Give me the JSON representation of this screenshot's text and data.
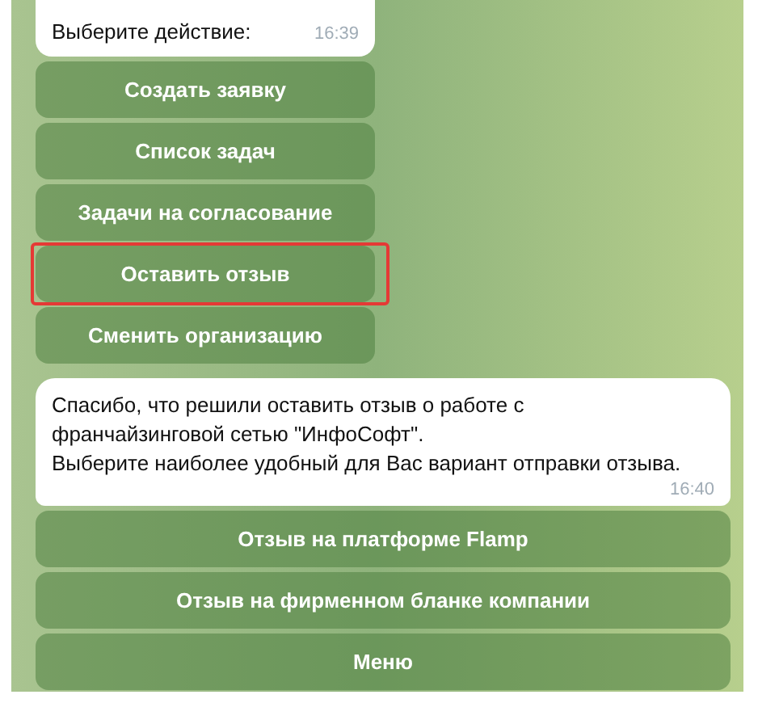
{
  "messages": [
    {
      "text": "Выберите действие:",
      "time": "16:39",
      "buttons": [
        {
          "label": "Создать заявку",
          "highlighted": false
        },
        {
          "label": "Список задач",
          "highlighted": false
        },
        {
          "label": "Задачи на согласование",
          "highlighted": false
        },
        {
          "label": "Оставить отзыв",
          "highlighted": true
        },
        {
          "label": "Сменить организацию",
          "highlighted": false
        }
      ]
    },
    {
      "text": "Спасибо, что решили оставить отзыв о работе с\nфранчайзинговой сетью \"ИнфоСофт\".\nВыберите наиболее удобный для Вас вариант отправки отзыва.",
      "time": "16:40",
      "buttons": [
        {
          "label": "Отзыв на платформе Flamp",
          "highlighted": false
        },
        {
          "label": "Отзыв на фирменном бланке компании",
          "highlighted": false
        },
        {
          "label": "Меню",
          "highlighted": false
        }
      ]
    }
  ]
}
